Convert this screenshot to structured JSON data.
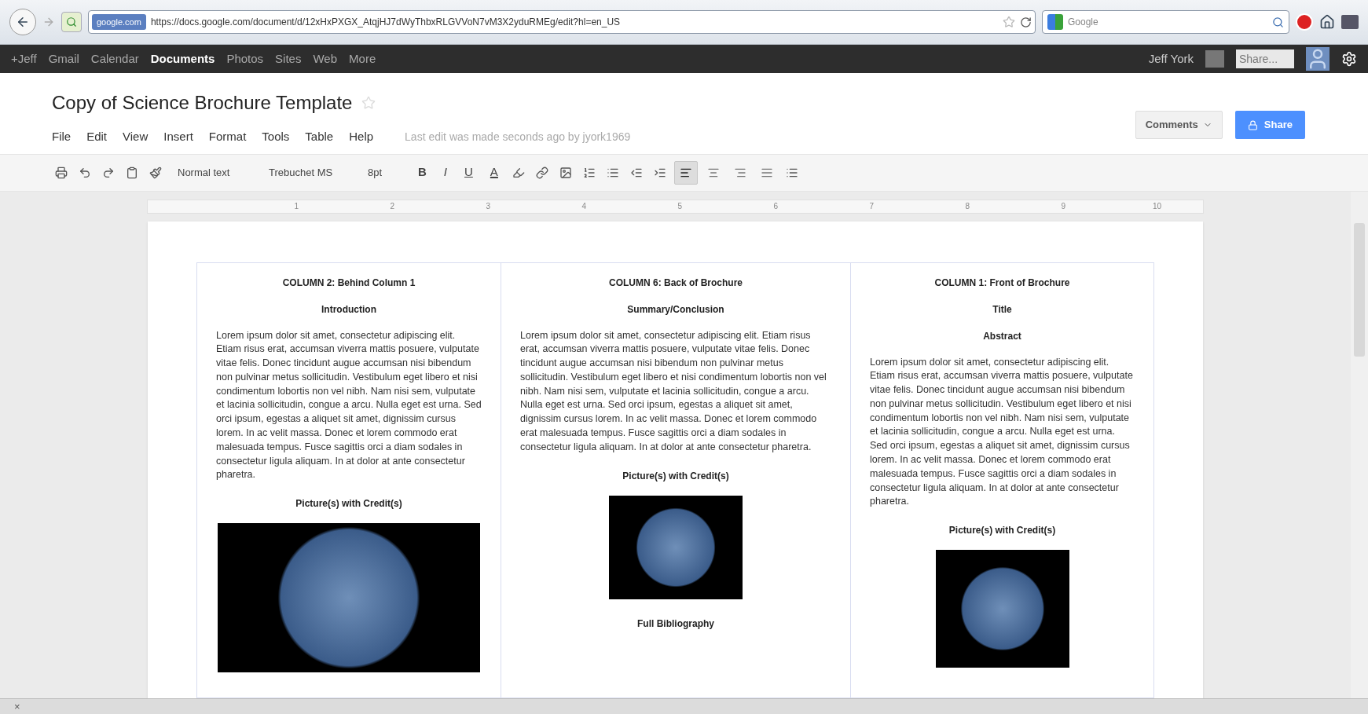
{
  "browser": {
    "url_host": "google.com",
    "url": "https://docs.google.com/document/d/12xHxPXGX_AtqjHJ7dWyThbxRLGVVoN7vM3X2yduRMEg/edit?hl=en_US",
    "search_placeholder": "Google"
  },
  "google_bar": {
    "items": [
      {
        "label": "+Jeff",
        "selected": false
      },
      {
        "label": "Gmail",
        "selected": false
      },
      {
        "label": "Calendar",
        "selected": false
      },
      {
        "label": "Documents",
        "selected": true
      },
      {
        "label": "Photos",
        "selected": false
      },
      {
        "label": "Sites",
        "selected": false
      },
      {
        "label": "Web",
        "selected": false
      },
      {
        "label": "More",
        "selected": false
      }
    ],
    "user": "Jeff York",
    "share_placeholder": "Share..."
  },
  "document": {
    "title": "Copy of Science Brochure Template",
    "starred": false,
    "menus": [
      "File",
      "Edit",
      "View",
      "Insert",
      "Format",
      "Tools",
      "Table",
      "Help"
    ],
    "last_edit": "Last edit was made seconds ago by jyork1969",
    "comments_button": "Comments",
    "share_button": "Share"
  },
  "toolbar": {
    "style": "Normal text",
    "font": "Trebuchet MS",
    "size": "8pt",
    "format_buttons": [
      {
        "label": "B",
        "kind": "bold"
      },
      {
        "label": "I",
        "kind": "italic"
      },
      {
        "label": "U",
        "kind": "underline"
      },
      {
        "label": "A",
        "kind": "color"
      }
    ],
    "alignments": [
      {
        "kind": "left",
        "selected": true
      },
      {
        "kind": "center",
        "selected": false
      },
      {
        "kind": "right",
        "selected": false
      },
      {
        "kind": "justify",
        "selected": false
      }
    ]
  },
  "ruler": {
    "marks": [
      "1",
      "2",
      "3",
      "4",
      "5",
      "6",
      "7",
      "8",
      "9",
      "10"
    ]
  },
  "columns": [
    {
      "blocks": [
        {
          "kind": "heading",
          "text": "COLUMN 2: Behind Column 1"
        },
        {
          "kind": "heading",
          "text": "Introduction"
        },
        {
          "kind": "paragraph",
          "text": "Lorem ipsum dolor sit amet, consectetur adipiscing elit. Etiam risus erat, accumsan viverra mattis posuere, vulputate vitae felis. Donec tincidunt augue accumsan nisi bibendum non pulvinar metus sollicitudin. Vestibulum eget libero et nisi condimentum lobortis non vel nibh. Nam nisi sem, vulputate et lacinia sollicitudin, congue a arcu. Nulla eget est urna. Sed orci ipsum, egestas a aliquet sit amet, dignissim cursus lorem. In ac velit massa. Donec et lorem commodo erat malesuada tempus. Fusce sagittis orci a diam sodales in consectetur ligula aliquam. In at dolor at ante consectetur pharetra."
        },
        {
          "kind": "heading",
          "text": "Picture(s) with Credit(s)"
        },
        {
          "kind": "picture"
        }
      ]
    },
    {
      "blocks": [
        {
          "kind": "heading",
          "text": "COLUMN 6: Back of Brochure"
        },
        {
          "kind": "heading",
          "text": "Summary/Conclusion"
        },
        {
          "kind": "paragraph",
          "text": "Lorem ipsum dolor sit amet, consectetur adipiscing elit. Etiam risus erat, accumsan viverra mattis posuere, vulputate vitae felis. Donec tincidunt augue accumsan nisi bibendum non pulvinar metus sollicitudin. Vestibulum eget libero et nisi condimentum lobortis non vel nibh. Nam nisi sem, vulputate et lacinia sollicitudin, congue a arcu. Nulla eget est urna. Sed orci ipsum, egestas a aliquet sit amet, dignissim cursus lorem. In ac velit massa. Donec et lorem commodo erat malesuada tempus. Fusce sagittis orci a diam sodales in consectetur ligula aliquam. In at dolor at ante consectetur pharetra."
        },
        {
          "kind": "heading",
          "text": "Picture(s) with Credit(s)"
        },
        {
          "kind": "picture"
        },
        {
          "kind": "heading",
          "text": "Full Bibliography"
        }
      ]
    },
    {
      "blocks": [
        {
          "kind": "heading",
          "text": "COLUMN 1: Front of Brochure"
        },
        {
          "kind": "heading",
          "text": "Title"
        },
        {
          "kind": "heading",
          "text": "Abstract"
        },
        {
          "kind": "paragraph",
          "text": "Lorem ipsum dolor sit amet, consectetur adipiscing elit. Etiam risus erat, accumsan viverra mattis posuere, vulputate vitae felis. Donec tincidunt augue accumsan nisi bibendum non pulvinar metus sollicitudin. Vestibulum eget libero et nisi condimentum lobortis non vel nibh. Nam nisi sem, vulputate et lacinia sollicitudin, congue a arcu. Nulla eget est urna. Sed orci ipsum, egestas a aliquet sit amet, dignissim cursus lorem. In ac velit massa. Donec et lorem commodo erat malesuada tempus. Fusce sagittis orci a diam sodales in consectetur ligula aliquam. In at dolor at ante consectetur pharetra."
        },
        {
          "kind": "heading",
          "text": "Picture(s) with Credit(s)"
        },
        {
          "kind": "picture"
        }
      ]
    }
  ],
  "status_bar": {
    "close": "×"
  }
}
